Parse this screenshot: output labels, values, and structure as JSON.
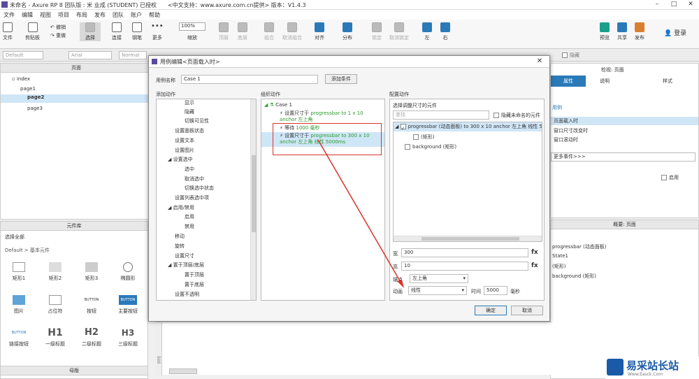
{
  "window": {
    "title": "未命名 - Axure RP 8 团队版 : 米 业成 (STUDENT) 已授权　　<中文支持：www.axure.com.cn提供> 版本：V1.4.3"
  },
  "menu": [
    "文件",
    "编辑",
    "视图",
    "项目",
    "布局",
    "发布",
    "团队",
    "账户",
    "帮助"
  ],
  "toolbar": {
    "file": "文件",
    "clipboard": "剪贴板",
    "undo": "撤销",
    "redo": "重做",
    "select": "选择",
    "connect": "连接",
    "pen": "钢笔",
    "more": "更多",
    "zoom_value": "100%",
    "zoom_label": "缩放",
    "top": "顶层",
    "bottom": "底层",
    "group": "组合",
    "ungroup": "取消组合",
    "align": "对齐",
    "distribute": "分布",
    "lock": "锁定",
    "unlock": "取消锁定",
    "left": "左",
    "right": "右",
    "preview": "预览",
    "share": "共享",
    "publish": "发布",
    "login": "登录"
  },
  "format": {
    "style": "Default",
    "font": "Arial",
    "weight": "Normal",
    "hide": "隐藏"
  },
  "pages": {
    "header": "页面",
    "items": [
      "index",
      "page1",
      "page2",
      "page3"
    ]
  },
  "library": {
    "header": "元件库",
    "select_all": "选择全部",
    "group": "Default > 基本元件",
    "items": [
      "矩形1",
      "矩形2",
      "矩形3",
      "椭圆形",
      "图片",
      "占位符",
      "按钮",
      "主要按钮",
      "链接按钮",
      "一级标题",
      "二级标题",
      "三级标题"
    ],
    "btn_text": "BUTTON",
    "h1": "H1",
    "h2": "H2",
    "h3": "H3"
  },
  "masters": {
    "header": "母版"
  },
  "inspector": {
    "title": "检视: 页面",
    "tabs": [
      "属性",
      "说明",
      "样式"
    ],
    "events": [
      "页面载入时",
      "窗口尺寸改变时",
      "窗口滚动时"
    ],
    "more": "更多事件>>>",
    "enable": "启用",
    "section": "用例"
  },
  "outline": {
    "header": "概要: 页面",
    "items": [
      "progressbar (动态面板)",
      "State1",
      "(矩形)",
      "background (矩形)"
    ]
  },
  "dialog": {
    "title": "用例编辑<页面载入时>",
    "case_name_label": "用例名称",
    "case_name": "Case 1",
    "add_condition": "添加条件",
    "add_action_title": "添加动作",
    "organize_title": "组织动作",
    "configure_title": "配置动作",
    "actions": [
      "显示",
      "隐藏",
      "切换可见性",
      "设置面板状态",
      "设置文本",
      "设置图片",
      "设置选中",
      "选中",
      "取消选中",
      "切换选中状态",
      "设置列表选中项",
      "启用/禁用",
      "启用",
      "禁用",
      "移动",
      "旋转",
      "设置尺寸",
      "置于顶层/底层",
      "置于顶层",
      "置于底层",
      "设置不透明"
    ],
    "case": "Case 1",
    "org_actions": [
      {
        "prefix": "设置尺寸于 ",
        "target": "progressbar to 1 x 10 anchor 左上角"
      },
      {
        "prefix": "等待 ",
        "target": "1000 毫秒"
      },
      {
        "prefix": "设置尺寸于 ",
        "target": "progressbar to 300 x 10 anchor 左上角 线性 5000ms"
      }
    ],
    "select_widget_label": "选择调整尺寸的元件",
    "search_placeholder": "查找",
    "hide_unnamed": "隐藏未命名的元件",
    "widgets": [
      "progressbar (动态面板) to 300 x 10 anchor 左上角 线性 5000ms",
      "(矩形)",
      "background (矩形)"
    ],
    "width_label": "宽",
    "width": "300",
    "height_label": "高",
    "height": "10",
    "anchor_label": "锚点",
    "anchor": "左上角",
    "anim_label": "动画",
    "anim": "线性",
    "time_label": "时间",
    "time": "5000",
    "ms": "毫秒",
    "fx": "fx",
    "ok": "确定",
    "cancel": "取消"
  },
  "canvas": {
    "ruler": "500"
  },
  "watermark": {
    "brand": "易采站长站",
    "url": "Www.Easck.Com"
  },
  "colors": {
    "accent": "#2a7ab8",
    "green": "#2a9a2a",
    "highlight": "#cfe6f7",
    "arrow": "#d9342b"
  }
}
